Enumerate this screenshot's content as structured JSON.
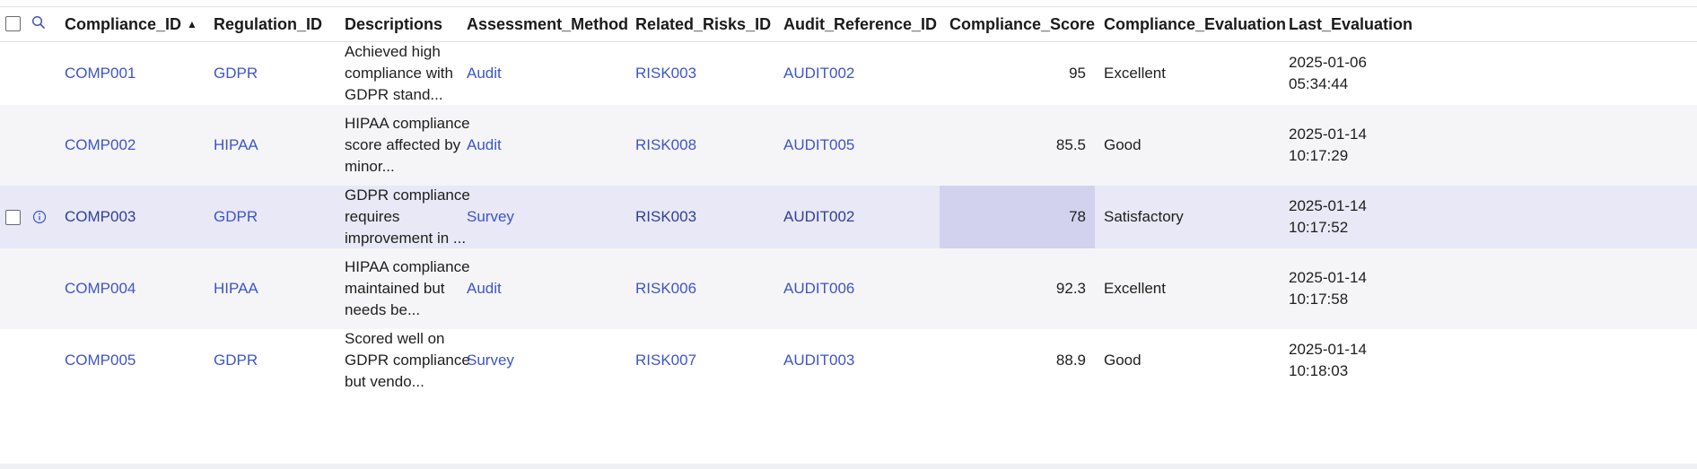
{
  "columns": {
    "compliance_id": "Compliance_ID",
    "regulation_id": "Regulation_ID",
    "descriptions": "Descriptions",
    "assessment_method": "Assessment_Method",
    "related_risks_id": "Related_Risks_ID",
    "audit_reference_id": "Audit_Reference_ID",
    "compliance_score": "Compliance_Score",
    "compliance_evaluation": "Compliance_Evaluation",
    "last_evaluation": "Last_Evaluation"
  },
  "sort": {
    "column": "Compliance_ID",
    "direction": "ascending",
    "indicator": "▲"
  },
  "colors": {
    "link": "#3d55c8",
    "selected_row": "#e8e8f6",
    "selected_cell": "#d2d2ef"
  },
  "rows": [
    {
      "compliance_id": "COMP001",
      "regulation_id": "GDPR",
      "descriptions": "Achieved high compliance with GDPR stand...",
      "assessment_method": "Audit",
      "related_risks_id": "RISK003",
      "audit_reference_id": "AUDIT002",
      "compliance_score": "95",
      "compliance_evaluation": "Excellent",
      "last_evaluation": "2025-01-06 05:34:44"
    },
    {
      "compliance_id": "COMP002",
      "regulation_id": "HIPAA",
      "descriptions": "HIPAA compliance score affected by minor...",
      "assessment_method": "Audit",
      "related_risks_id": "RISK008",
      "audit_reference_id": "AUDIT005",
      "compliance_score": "85.5",
      "compliance_evaluation": "Good",
      "last_evaluation": "2025-01-14 10:17:29"
    },
    {
      "compliance_id": "COMP003",
      "regulation_id": "GDPR",
      "descriptions": "GDPR compliance requires improvement in ...",
      "assessment_method": "Survey",
      "related_risks_id": "RISK003",
      "audit_reference_id": "AUDIT002",
      "compliance_score": "78",
      "compliance_evaluation": "Satisfactory",
      "last_evaluation": "2025-01-14 10:17:52"
    },
    {
      "compliance_id": "COMP004",
      "regulation_id": "HIPAA",
      "descriptions": "HIPAA compliance maintained but needs be...",
      "assessment_method": "Audit",
      "related_risks_id": "RISK006",
      "audit_reference_id": "AUDIT006",
      "compliance_score": "92.3",
      "compliance_evaluation": "Excellent",
      "last_evaluation": "2025-01-14 10:17:58"
    },
    {
      "compliance_id": "COMP005",
      "regulation_id": "GDPR",
      "descriptions": "Scored well on GDPR compliance but vendo...",
      "assessment_method": "Survey",
      "related_risks_id": "RISK007",
      "audit_reference_id": "AUDIT003",
      "compliance_score": "88.9",
      "compliance_evaluation": "Good",
      "last_evaluation": "2025-01-14 10:18:03"
    }
  ],
  "icons": {
    "header_search": "search-icon",
    "row_info": "info-icon"
  }
}
